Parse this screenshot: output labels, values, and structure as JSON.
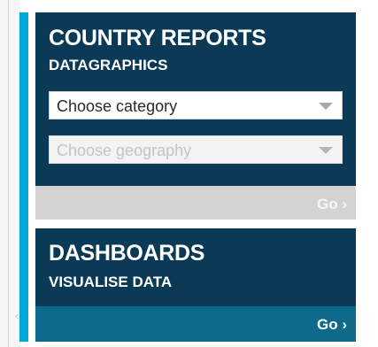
{
  "country_reports": {
    "title": "COUNTRY REPORTS",
    "subtitle": "DATAGRAPHICS",
    "category_select": {
      "value": "Choose category",
      "caret_icon": "caret-down-icon"
    },
    "geography_select": {
      "value": "Choose geography",
      "disabled": true,
      "caret_icon": "caret-down-icon"
    },
    "go_label": "Go ›"
  },
  "dashboards": {
    "title": "DASHBOARDS",
    "subtitle": "VISUALISE DATA",
    "go_label": "Go ›"
  },
  "left_rail": {
    "chevron": "‹"
  },
  "colors": {
    "panel": "#0b3a56",
    "accent": "#00a7db",
    "go_bar_disabled": "#d3d3d3",
    "go_bar_active": "#0d6a8a"
  }
}
